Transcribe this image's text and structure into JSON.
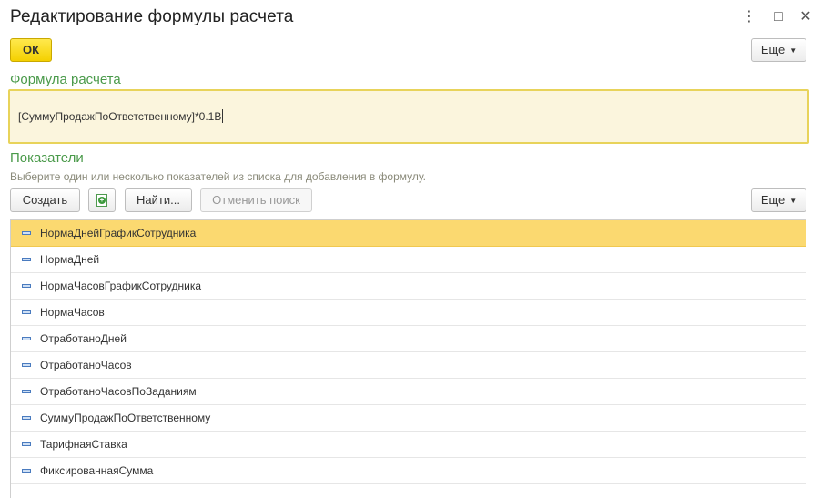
{
  "window": {
    "title": "Редактирование формулы расчета",
    "more_icon": "⋮",
    "maximize_icon": "□",
    "close_icon": "✕"
  },
  "toolbar": {
    "ok_label": "ОК",
    "more_label": "Еще"
  },
  "formula": {
    "section_title": "Формула расчета",
    "value": "[СуммуПродажПоОтветственному]*0.1В"
  },
  "indicators": {
    "section_title": "Показатели",
    "hint": "Выберите один или несколько показателей из списка для добавления в формулу.",
    "create_label": "Создать",
    "find_label": "Найти...",
    "cancel_search_label": "Отменить поиск",
    "more_label": "Еще",
    "selected_index": 0,
    "items": [
      "НормаДнейГрафикСотрудника",
      "НормаДней",
      "НормаЧасовГрафикСотрудника",
      "НормаЧасов",
      "ОтработаноДней",
      "ОтработаноЧасов",
      "ОтработаноЧасовПоЗаданиям",
      "СуммуПродажПоОтветственному",
      "ТарифнаяСтавка",
      "ФиксированнаяСумма"
    ]
  }
}
